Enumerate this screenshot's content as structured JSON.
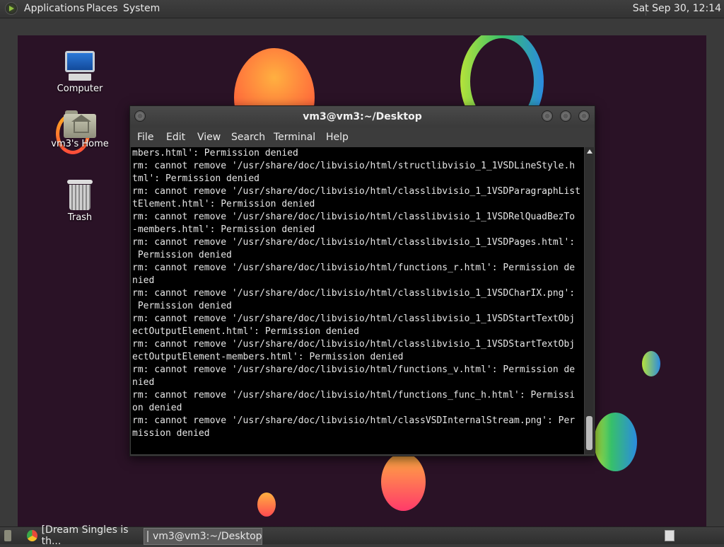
{
  "top_panel": {
    "menus": [
      "Applications",
      "Places",
      "System"
    ],
    "clock": "Sat Sep 30, 12:14"
  },
  "desktop_icons": {
    "computer": "Computer",
    "home": "vm3's Home",
    "trash": "Trash"
  },
  "terminal": {
    "title": "vm3@vm3:~/Desktop",
    "menus": [
      "File",
      "Edit",
      "View",
      "Search",
      "Terminal",
      "Help"
    ],
    "lines": [
      "mbers.html': Permission denied",
      "rm: cannot remove '/usr/share/doc/libvisio/html/structlibvisio_1_1VSDLineStyle.h",
      "tml': Permission denied",
      "rm: cannot remove '/usr/share/doc/libvisio/html/classlibvisio_1_1VSDParagraphList",
      "tElement.html': Permission denied",
      "rm: cannot remove '/usr/share/doc/libvisio/html/classlibvisio_1_1VSDRelQuadBezTo",
      "-members.html': Permission denied",
      "rm: cannot remove '/usr/share/doc/libvisio/html/classlibvisio_1_1VSDPages.html':",
      " Permission denied",
      "rm: cannot remove '/usr/share/doc/libvisio/html/functions_r.html': Permission de",
      "nied",
      "rm: cannot remove '/usr/share/doc/libvisio/html/classlibvisio_1_1VSDCharIX.png':",
      " Permission denied",
      "rm: cannot remove '/usr/share/doc/libvisio/html/classlibvisio_1_1VSDStartTextObj",
      "ectOutputElement.html': Permission denied",
      "rm: cannot remove '/usr/share/doc/libvisio/html/classlibvisio_1_1VSDStartTextObj",
      "ectOutputElement-members.html': Permission denied",
      "rm: cannot remove '/usr/share/doc/libvisio/html/functions_v.html': Permission de",
      "nied",
      "rm: cannot remove '/usr/share/doc/libvisio/html/functions_func_h.html': Permissi",
      "on denied",
      "rm: cannot remove '/usr/share/doc/libvisio/html/classVSDInternalStream.png': Per",
      "mission denied"
    ]
  },
  "taskbar": {
    "items": [
      "[Dream Singles is th...",
      "vm3@vm3:~/Desktop"
    ]
  }
}
